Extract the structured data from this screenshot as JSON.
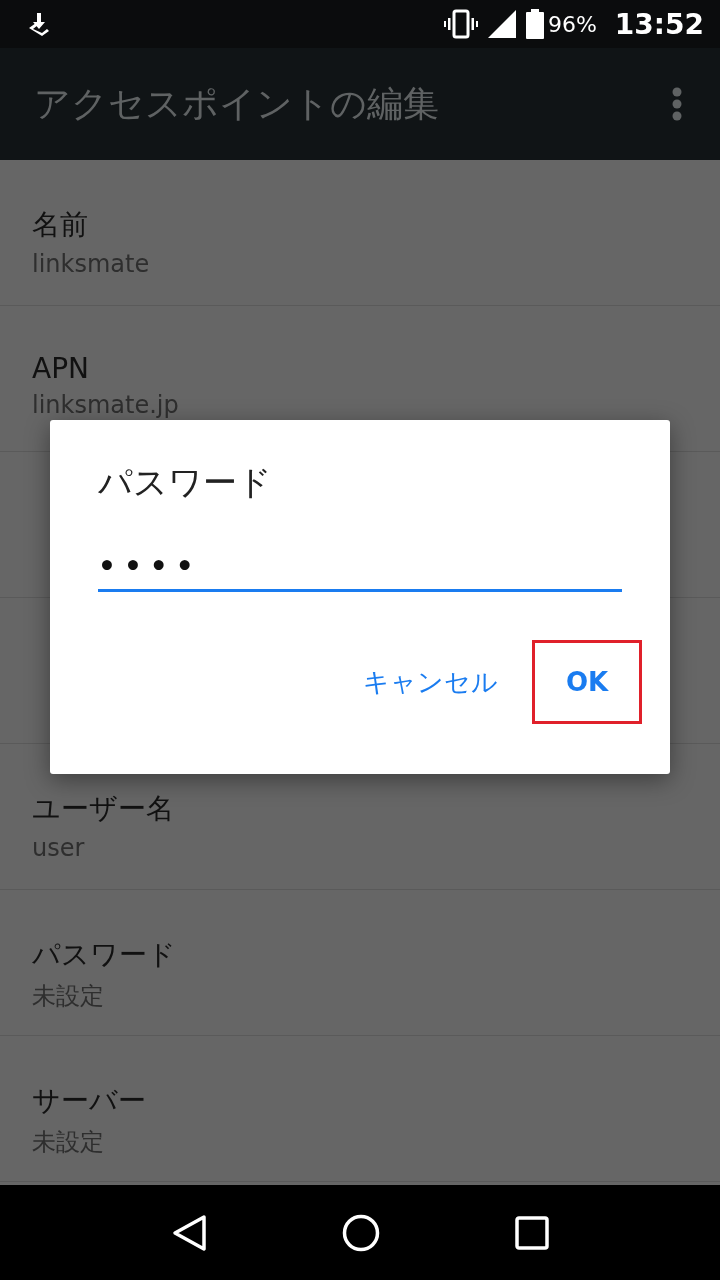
{
  "status_bar": {
    "battery": "96%",
    "time": "13:52"
  },
  "app_bar": {
    "title": "アクセスポイントの編集"
  },
  "settings": [
    {
      "covered": false,
      "label": "名前",
      "value": "linksmate"
    },
    {
      "covered": false,
      "label": "APN",
      "value": "linksmate.jp"
    },
    {
      "covered": true
    },
    {
      "covered": true
    },
    {
      "covered": false,
      "label": "ユーザー名",
      "value": "user"
    },
    {
      "covered": false,
      "label": "パスワード",
      "value": "未設定"
    },
    {
      "covered": false,
      "label": "サーバー",
      "value": "未設定"
    }
  ],
  "dialog": {
    "title": "パスワード",
    "field_value": "••••",
    "buttons": [
      {
        "label": "キャンセル",
        "highlighted": false
      },
      {
        "label": "OK",
        "highlighted": true
      }
    ]
  }
}
